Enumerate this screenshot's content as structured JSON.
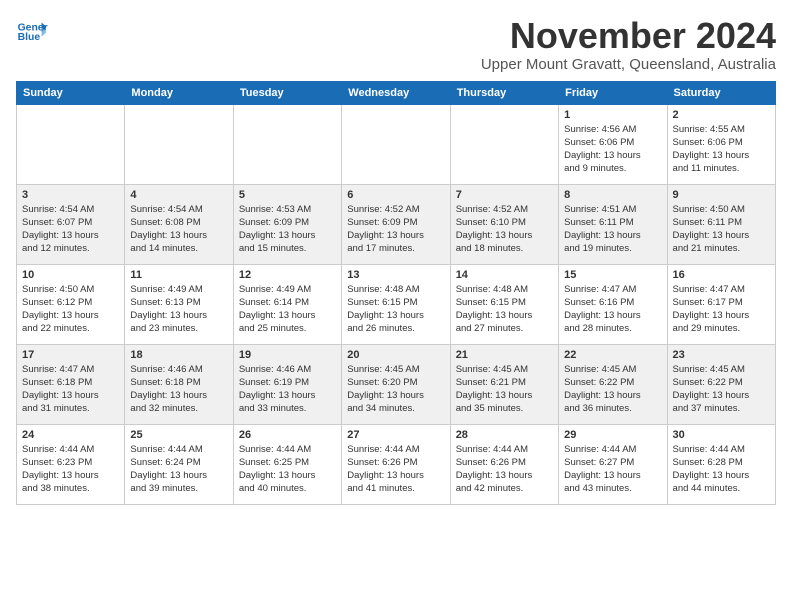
{
  "header": {
    "logo_line1": "General",
    "logo_line2": "Blue",
    "month_title": "November 2024",
    "subtitle": "Upper Mount Gravatt, Queensland, Australia"
  },
  "days_of_week": [
    "Sunday",
    "Monday",
    "Tuesday",
    "Wednesday",
    "Thursday",
    "Friday",
    "Saturday"
  ],
  "weeks": [
    [
      {
        "day": "",
        "info": ""
      },
      {
        "day": "",
        "info": ""
      },
      {
        "day": "",
        "info": ""
      },
      {
        "day": "",
        "info": ""
      },
      {
        "day": "",
        "info": ""
      },
      {
        "day": "1",
        "info": "Sunrise: 4:56 AM\nSunset: 6:06 PM\nDaylight: 13 hours\nand 9 minutes."
      },
      {
        "day": "2",
        "info": "Sunrise: 4:55 AM\nSunset: 6:06 PM\nDaylight: 13 hours\nand 11 minutes."
      }
    ],
    [
      {
        "day": "3",
        "info": "Sunrise: 4:54 AM\nSunset: 6:07 PM\nDaylight: 13 hours\nand 12 minutes."
      },
      {
        "day": "4",
        "info": "Sunrise: 4:54 AM\nSunset: 6:08 PM\nDaylight: 13 hours\nand 14 minutes."
      },
      {
        "day": "5",
        "info": "Sunrise: 4:53 AM\nSunset: 6:09 PM\nDaylight: 13 hours\nand 15 minutes."
      },
      {
        "day": "6",
        "info": "Sunrise: 4:52 AM\nSunset: 6:09 PM\nDaylight: 13 hours\nand 17 minutes."
      },
      {
        "day": "7",
        "info": "Sunrise: 4:52 AM\nSunset: 6:10 PM\nDaylight: 13 hours\nand 18 minutes."
      },
      {
        "day": "8",
        "info": "Sunrise: 4:51 AM\nSunset: 6:11 PM\nDaylight: 13 hours\nand 19 minutes."
      },
      {
        "day": "9",
        "info": "Sunrise: 4:50 AM\nSunset: 6:11 PM\nDaylight: 13 hours\nand 21 minutes."
      }
    ],
    [
      {
        "day": "10",
        "info": "Sunrise: 4:50 AM\nSunset: 6:12 PM\nDaylight: 13 hours\nand 22 minutes."
      },
      {
        "day": "11",
        "info": "Sunrise: 4:49 AM\nSunset: 6:13 PM\nDaylight: 13 hours\nand 23 minutes."
      },
      {
        "day": "12",
        "info": "Sunrise: 4:49 AM\nSunset: 6:14 PM\nDaylight: 13 hours\nand 25 minutes."
      },
      {
        "day": "13",
        "info": "Sunrise: 4:48 AM\nSunset: 6:15 PM\nDaylight: 13 hours\nand 26 minutes."
      },
      {
        "day": "14",
        "info": "Sunrise: 4:48 AM\nSunset: 6:15 PM\nDaylight: 13 hours\nand 27 minutes."
      },
      {
        "day": "15",
        "info": "Sunrise: 4:47 AM\nSunset: 6:16 PM\nDaylight: 13 hours\nand 28 minutes."
      },
      {
        "day": "16",
        "info": "Sunrise: 4:47 AM\nSunset: 6:17 PM\nDaylight: 13 hours\nand 29 minutes."
      }
    ],
    [
      {
        "day": "17",
        "info": "Sunrise: 4:47 AM\nSunset: 6:18 PM\nDaylight: 13 hours\nand 31 minutes."
      },
      {
        "day": "18",
        "info": "Sunrise: 4:46 AM\nSunset: 6:18 PM\nDaylight: 13 hours\nand 32 minutes."
      },
      {
        "day": "19",
        "info": "Sunrise: 4:46 AM\nSunset: 6:19 PM\nDaylight: 13 hours\nand 33 minutes."
      },
      {
        "day": "20",
        "info": "Sunrise: 4:45 AM\nSunset: 6:20 PM\nDaylight: 13 hours\nand 34 minutes."
      },
      {
        "day": "21",
        "info": "Sunrise: 4:45 AM\nSunset: 6:21 PM\nDaylight: 13 hours\nand 35 minutes."
      },
      {
        "day": "22",
        "info": "Sunrise: 4:45 AM\nSunset: 6:22 PM\nDaylight: 13 hours\nand 36 minutes."
      },
      {
        "day": "23",
        "info": "Sunrise: 4:45 AM\nSunset: 6:22 PM\nDaylight: 13 hours\nand 37 minutes."
      }
    ],
    [
      {
        "day": "24",
        "info": "Sunrise: 4:44 AM\nSunset: 6:23 PM\nDaylight: 13 hours\nand 38 minutes."
      },
      {
        "day": "25",
        "info": "Sunrise: 4:44 AM\nSunset: 6:24 PM\nDaylight: 13 hours\nand 39 minutes."
      },
      {
        "day": "26",
        "info": "Sunrise: 4:44 AM\nSunset: 6:25 PM\nDaylight: 13 hours\nand 40 minutes."
      },
      {
        "day": "27",
        "info": "Sunrise: 4:44 AM\nSunset: 6:26 PM\nDaylight: 13 hours\nand 41 minutes."
      },
      {
        "day": "28",
        "info": "Sunrise: 4:44 AM\nSunset: 6:26 PM\nDaylight: 13 hours\nand 42 minutes."
      },
      {
        "day": "29",
        "info": "Sunrise: 4:44 AM\nSunset: 6:27 PM\nDaylight: 13 hours\nand 43 minutes."
      },
      {
        "day": "30",
        "info": "Sunrise: 4:44 AM\nSunset: 6:28 PM\nDaylight: 13 hours\nand 44 minutes."
      }
    ]
  ]
}
